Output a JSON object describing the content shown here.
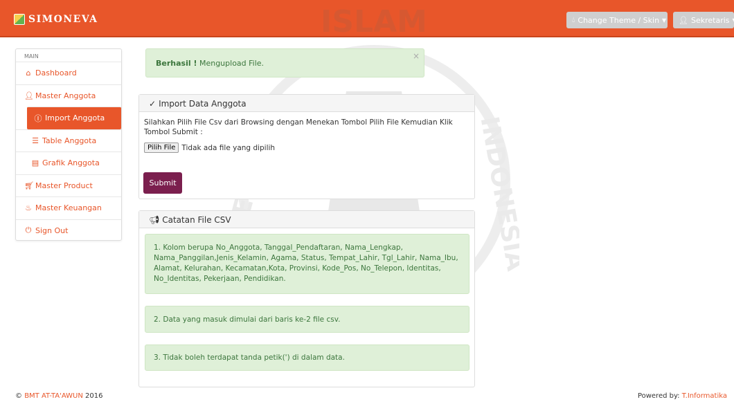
{
  "navbar": {
    "brand": "SIMONEVA",
    "theme_button": "Change Theme / Skin",
    "user_button": "Sekretaris"
  },
  "watermark": {
    "text_top": "ISLAM",
    "text_left": "UNIVERSITAS",
    "text_right": "INDONESIA"
  },
  "sidebar": {
    "heading": "MAIN",
    "items": [
      {
        "label": "Dashboard",
        "icon": "home-icon"
      },
      {
        "label": "Master Anggota",
        "icon": "user-icon"
      },
      {
        "label": "Import Anggota",
        "icon": "upload-circle-icon",
        "active": true
      },
      {
        "label": "Table Anggota",
        "icon": "list-icon"
      },
      {
        "label": "Grafik Anggota",
        "icon": "table-icon"
      },
      {
        "label": "Master Product",
        "icon": "cart-icon"
      },
      {
        "label": "Master Keuangan",
        "icon": "fire-icon"
      },
      {
        "label": "Sign Out",
        "icon": "power-icon"
      }
    ]
  },
  "alert": {
    "strong": "Berhasil !",
    "message": " Mengupload File.",
    "close": "×"
  },
  "import_panel": {
    "title": "Import Data Anggota",
    "description": "Silahkan Pilih File Csv dari Browsing dengan Menekan Tombol Pilih File Kemudian Klik Tombol Submit :",
    "file_button": "Pilih File",
    "file_status": "Tidak ada file yang dipilih",
    "submit": "Submit"
  },
  "notes_panel": {
    "title": "Catatan File CSV",
    "notes": [
      "1. Kolom berupa No_Anggota, Tanggal_Pendaftaran, Nama_Lengkap, Nama_Panggilan,Jenis_Kelamin, Agama, Status, Tempat_Lahir, Tgl_Lahir, Nama_Ibu, Alamat, Kelurahan, Kecamatan,Kota, Provinsi, Kode_Pos, No_Telepon, Identitas, No_Identitas, Pekerjaan, Pendidikan.",
      "2. Data yang masuk dimulai dari baris ke-2 file csv.",
      "3. Tidak boleh terdapat tanda petik(') di dalam data."
    ]
  },
  "footer": {
    "copyright_prefix": "© ",
    "org": "BMT AT-TA'AWUN",
    "year": " 2016",
    "powered_prefix": "Powered by: ",
    "powered_by": "T.Informatika"
  },
  "colors": {
    "accent": "#e8562a",
    "success_bg": "#dff0d8",
    "success_text": "#3c763d",
    "submit": "#7b1f4e"
  }
}
